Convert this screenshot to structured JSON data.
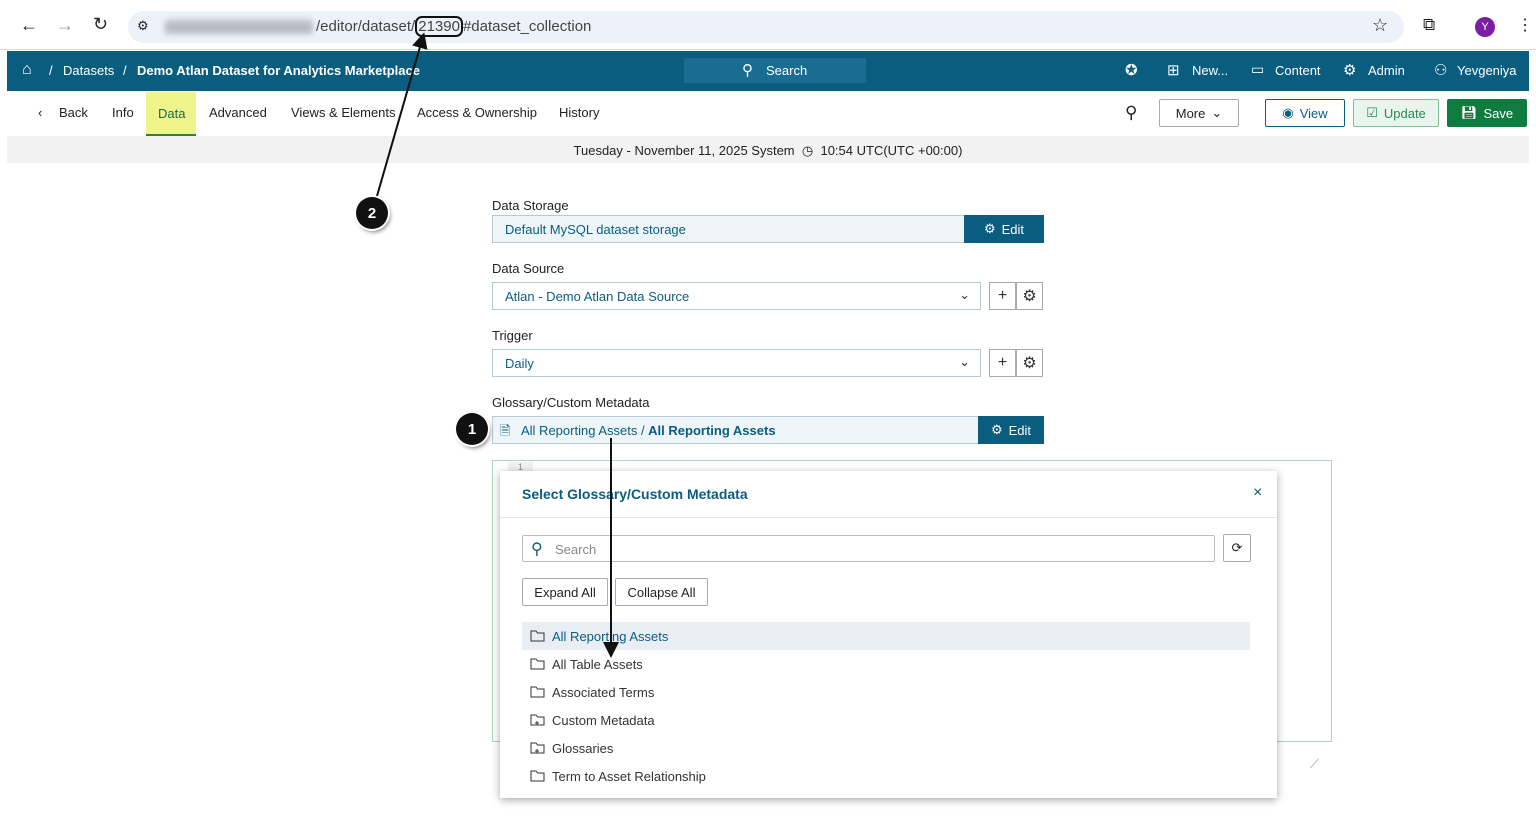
{
  "browser": {
    "url_path": "/editor/dataset/",
    "url_id": "21390",
    "url_hash": "#dataset_collection",
    "profile_initial": "Y"
  },
  "navbar": {
    "breadcrumb": [
      "Datasets",
      "Demo Atlan Dataset for Analytics Marketplace"
    ],
    "search": "Search",
    "new": "New...",
    "content": "Content",
    "admin": "Admin",
    "user": "Yevgeniya"
  },
  "tabs": {
    "back": "Back",
    "items": [
      "Info",
      "Data",
      "Advanced",
      "Views & Elements",
      "Access & Ownership",
      "History"
    ],
    "active": "Data",
    "more": "More",
    "view": "View",
    "update": "Update",
    "save": "Save"
  },
  "datebar": {
    "date": "Tuesday - November 11, 2025 System",
    "time": "10:54 UTC(UTC +00:00)"
  },
  "form": {
    "storage": {
      "label": "Data Storage",
      "value": "Default MySQL dataset storage",
      "edit": "Edit"
    },
    "source": {
      "label": "Data Source",
      "value": "Atlan - Demo Atlan Data Source"
    },
    "trigger": {
      "label": "Trigger",
      "value": "Daily"
    },
    "glossary": {
      "label": "Glossary/Custom Metadata",
      "value_prefix": "All Reporting Assets / ",
      "value_bold": "All Reporting Assets",
      "edit": "Edit"
    },
    "editor_line": "1"
  },
  "modal": {
    "title": "Select Glossary/Custom Metadata",
    "search_placeholder": "Search",
    "expand": "Expand All",
    "collapse": "Collapse All",
    "items": [
      {
        "label": "All Reporting Assets",
        "icon": "folder-icon",
        "selected": true
      },
      {
        "label": "All Table Assets",
        "icon": "folder-icon"
      },
      {
        "label": "Associated Terms",
        "icon": "folder-icon"
      },
      {
        "label": "Custom Metadata",
        "icon": "folder-plus-icon"
      },
      {
        "label": "Glossaries",
        "icon": "folder-plus-icon"
      },
      {
        "label": "Term to Asset Relationship",
        "icon": "folder-icon"
      }
    ]
  },
  "annotations": [
    "1",
    "2"
  ],
  "colors": {
    "brand": "#0b5d80",
    "save": "#0e7c3f",
    "active_tab": "#eef38a"
  }
}
